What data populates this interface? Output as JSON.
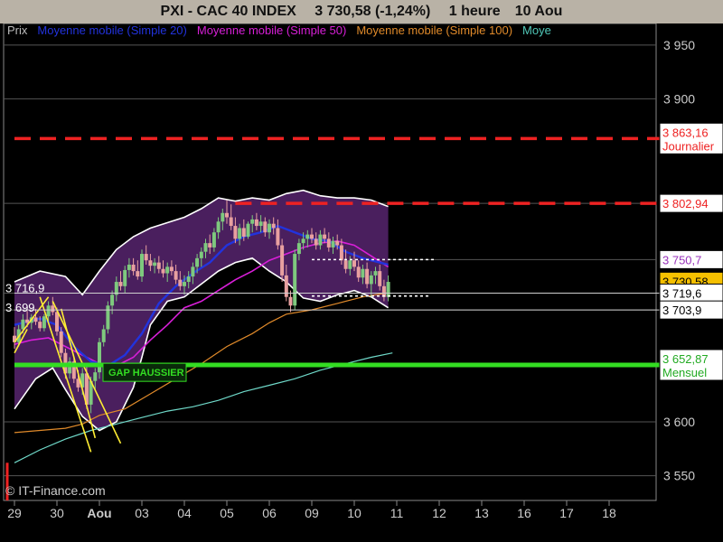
{
  "header": {
    "symbol": "PXI - CAC 40 INDEX",
    "last": "3 730,58 (-1,24%)",
    "period": "1 heure",
    "date": "10 Aou"
  },
  "legend": [
    {
      "label": "Prix",
      "color": "#bbbbbb"
    },
    {
      "label": "Moyenne mobile (Simple 20)",
      "color": "#2233dd"
    },
    {
      "label": "Moyenne mobile (Simple 50)",
      "color": "#d81fd8"
    },
    {
      "label": "Moyenne mobile (Simple 100)",
      "color": "#e08a2a"
    },
    {
      "label": "Moye",
      "color": "#50c8b8"
    }
  ],
  "watermark": "© IT-Finance.com",
  "colors": {
    "background": "#000000",
    "bollinger_fill": "#4a1f5e",
    "up_candle": "#7ec97e",
    "down_candle": "#e8a0a0",
    "ma20": "#2233dd",
    "ma50": "#d81fd8",
    "ma100": "#e08a2a",
    "ma200": "#6fd9c9",
    "resistance": "#ee2222",
    "support": "#33dd22",
    "trend": "#ffee33"
  },
  "chart_data": {
    "type": "candlestick",
    "y_range": [
      3527,
      3970
    ],
    "y_ticks": [
      {
        "value": 3950,
        "label": "3 950"
      },
      {
        "value": 3900,
        "label": "3 900"
      },
      {
        "value": 3600,
        "label": "3 600"
      },
      {
        "value": 3550,
        "label": "3 550"
      }
    ],
    "x_labels": [
      {
        "i": 0,
        "label": "29"
      },
      {
        "i": 1,
        "label": "30"
      },
      {
        "i": 2,
        "label": "Aou"
      },
      {
        "i": 3,
        "label": "03"
      },
      {
        "i": 4,
        "label": "04"
      },
      {
        "i": 5,
        "label": "05"
      },
      {
        "i": 6,
        "label": "06"
      },
      {
        "i": 7,
        "label": "09"
      },
      {
        "i": 8,
        "label": "10"
      },
      {
        "i": 9,
        "label": "11"
      },
      {
        "i": 10,
        "label": "12"
      },
      {
        "i": 11,
        "label": "13"
      },
      {
        "i": 12,
        "label": "16"
      },
      {
        "i": 13,
        "label": "17"
      },
      {
        "i": 14,
        "label": "18"
      }
    ],
    "price_tags": [
      {
        "value": 3863.16,
        "label": "3 863,16",
        "sub": "Journalier",
        "bg": "#ffffff",
        "fg": "#ee2222"
      },
      {
        "value": 3802.94,
        "label": "3 802,94",
        "bg": "#ffffff",
        "fg": "#ee2222"
      },
      {
        "value": 3750.7,
        "label": "3 750,7",
        "bg": "#ffffff",
        "fg": "#9933bb"
      },
      {
        "value": 3730.58,
        "label": "3 730,58",
        "bg": "#f5c000",
        "fg": "#000000"
      },
      {
        "value": 3719.6,
        "label": "3 719,6",
        "bg": "#ffffff",
        "fg": "#000000"
      },
      {
        "value": 3703.9,
        "label": "3 703,9",
        "bg": "#ffffff",
        "fg": "#000000"
      },
      {
        "value": 3652.87,
        "label": "3 652,87",
        "sub": "Mensuel",
        "bg": "#ffffff",
        "fg": "#22aa22"
      }
    ],
    "left_labels": [
      {
        "value": 3716.9,
        "label": "3 716,9"
      },
      {
        "value": 3699,
        "label": "3 699"
      }
    ],
    "levels": [
      {
        "name": "resistance-journalier",
        "value": 3863.16,
        "from": 0,
        "to": 15.2
      },
      {
        "name": "resistance-3802",
        "value": 3802.94,
        "from": 5.2,
        "to": 15.2
      },
      {
        "name": "support-mensuel",
        "value": 3652.87,
        "from": 0,
        "to": 15.2
      },
      {
        "name": "pivot-3703",
        "value": 3703.9,
        "from": 0,
        "to": 15.2
      },
      {
        "name": "pivot-3719",
        "value": 3719.6,
        "from": 0,
        "to": 15.2
      }
    ],
    "dotted_levels": [
      {
        "value": 3750.7,
        "from": 7.0,
        "to": 9.9
      },
      {
        "value": 3716.9,
        "from": 7.0,
        "to": 9.8
      }
    ],
    "annotation": {
      "label": "GAP HAUSSIER",
      "x": 2.0,
      "y": 3646
    },
    "candles": [
      [
        0.0,
        3680,
        3688,
        3668,
        3674
      ],
      [
        0.1,
        3674,
        3690,
        3670,
        3686
      ],
      [
        0.2,
        3686,
        3700,
        3682,
        3695
      ],
      [
        0.3,
        3695,
        3703,
        3688,
        3692
      ],
      [
        0.4,
        3692,
        3700,
        3686,
        3697
      ],
      [
        0.5,
        3697,
        3705,
        3690,
        3693
      ],
      [
        0.6,
        3693,
        3698,
        3684,
        3687
      ],
      [
        0.7,
        3687,
        3700,
        3684,
        3698
      ],
      [
        0.8,
        3698,
        3712,
        3694,
        3708
      ],
      [
        0.9,
        3708,
        3716,
        3699,
        3702
      ],
      [
        1.0,
        3702,
        3706,
        3680,
        3684
      ],
      [
        1.1,
        3684,
        3688,
        3660,
        3664
      ],
      [
        1.2,
        3664,
        3668,
        3640,
        3645
      ],
      [
        1.3,
        3645,
        3660,
        3640,
        3656
      ],
      [
        1.4,
        3656,
        3660,
        3636,
        3640
      ],
      [
        1.5,
        3640,
        3648,
        3628,
        3632
      ],
      [
        1.6,
        3632,
        3650,
        3625,
        3645
      ],
      [
        1.7,
        3645,
        3652,
        3612,
        3616
      ],
      [
        1.8,
        3616,
        3642,
        3608,
        3638
      ],
      [
        1.9,
        3638,
        3650,
        3630,
        3646
      ],
      [
        2.0,
        3646,
        3678,
        3640,
        3674
      ],
      [
        2.1,
        3674,
        3690,
        3670,
        3686
      ],
      [
        2.2,
        3686,
        3712,
        3682,
        3708
      ],
      [
        2.3,
        3708,
        3722,
        3700,
        3718
      ],
      [
        2.4,
        3718,
        3735,
        3712,
        3730
      ],
      [
        2.5,
        3730,
        3740,
        3722,
        3726
      ],
      [
        2.6,
        3726,
        3745,
        3720,
        3741
      ],
      [
        2.7,
        3741,
        3752,
        3734,
        3746
      ],
      [
        2.8,
        3746,
        3752,
        3736,
        3740
      ],
      [
        2.9,
        3740,
        3750,
        3732,
        3735
      ],
      [
        3.0,
        3735,
        3760,
        3730,
        3756
      ],
      [
        3.1,
        3756,
        3764,
        3746,
        3750
      ],
      [
        3.2,
        3750,
        3756,
        3740,
        3745
      ],
      [
        3.3,
        3745,
        3752,
        3738,
        3748
      ],
      [
        3.4,
        3748,
        3754,
        3738,
        3742
      ],
      [
        3.5,
        3742,
        3750,
        3734,
        3738
      ],
      [
        3.6,
        3738,
        3748,
        3730,
        3744
      ],
      [
        3.7,
        3744,
        3750,
        3736,
        3740
      ],
      [
        3.8,
        3740,
        3746,
        3728,
        3732
      ],
      [
        3.9,
        3732,
        3740,
        3722,
        3726
      ],
      [
        4.0,
        3726,
        3736,
        3718,
        3730
      ],
      [
        4.1,
        3730,
        3740,
        3724,
        3735
      ],
      [
        4.2,
        3735,
        3748,
        3728,
        3744
      ],
      [
        4.3,
        3744,
        3756,
        3738,
        3752
      ],
      [
        4.4,
        3752,
        3762,
        3744,
        3758
      ],
      [
        4.5,
        3758,
        3770,
        3752,
        3766
      ],
      [
        4.6,
        3766,
        3774,
        3756,
        3762
      ],
      [
        4.7,
        3762,
        3780,
        3758,
        3776
      ],
      [
        4.8,
        3776,
        3790,
        3770,
        3786
      ],
      [
        4.9,
        3786,
        3798,
        3778,
        3794
      ],
      [
        5.0,
        3794,
        3806,
        3784,
        3790
      ],
      [
        5.1,
        3790,
        3802,
        3778,
        3782
      ],
      [
        5.2,
        3782,
        3790,
        3766,
        3770
      ],
      [
        5.3,
        3770,
        3784,
        3764,
        3780
      ],
      [
        5.4,
        3780,
        3788,
        3768,
        3772
      ],
      [
        5.5,
        3772,
        3786,
        3770,
        3784
      ],
      [
        5.6,
        3784,
        3792,
        3776,
        3788
      ],
      [
        5.7,
        3788,
        3794,
        3778,
        3782
      ],
      [
        5.8,
        3782,
        3792,
        3776,
        3786
      ],
      [
        5.9,
        3786,
        3790,
        3772,
        3776
      ],
      [
        6.0,
        3776,
        3788,
        3770,
        3784
      ],
      [
        6.1,
        3784,
        3790,
        3774,
        3780
      ],
      [
        6.2,
        3780,
        3788,
        3760,
        3764
      ],
      [
        6.3,
        3764,
        3770,
        3730,
        3736
      ],
      [
        6.4,
        3736,
        3746,
        3712,
        3716
      ],
      [
        6.5,
        3716,
        3722,
        3702,
        3708
      ],
      [
        6.6,
        3708,
        3760,
        3704,
        3756
      ],
      [
        6.7,
        3756,
        3770,
        3750,
        3766
      ],
      [
        6.8,
        3766,
        3776,
        3760,
        3770
      ],
      [
        6.9,
        3770,
        3778,
        3762,
        3774
      ],
      [
        7.0,
        3774,
        3780,
        3766,
        3770
      ],
      [
        7.1,
        3770,
        3776,
        3760,
        3764
      ],
      [
        7.2,
        3764,
        3778,
        3760,
        3774
      ],
      [
        7.3,
        3774,
        3780,
        3766,
        3770
      ],
      [
        7.4,
        3770,
        3776,
        3758,
        3762
      ],
      [
        7.5,
        3762,
        3772,
        3756,
        3768
      ],
      [
        7.6,
        3768,
        3774,
        3760,
        3764
      ],
      [
        7.7,
        3764,
        3770,
        3746,
        3750
      ],
      [
        7.8,
        3750,
        3760,
        3738,
        3742
      ],
      [
        7.9,
        3742,
        3754,
        3736,
        3750
      ],
      [
        8.0,
        3750,
        3758,
        3740,
        3744
      ],
      [
        8.1,
        3744,
        3750,
        3730,
        3734
      ],
      [
        8.2,
        3734,
        3746,
        3728,
        3742
      ],
      [
        8.3,
        3742,
        3748,
        3724,
        3728
      ],
      [
        8.4,
        3728,
        3740,
        3716,
        3736
      ],
      [
        8.5,
        3736,
        3744,
        3728,
        3740
      ],
      [
        8.6,
        3740,
        3746,
        3722,
        3726
      ],
      [
        8.7,
        3726,
        3732,
        3712,
        3716
      ],
      [
        8.8,
        3716,
        3736,
        3712,
        3730
      ]
    ],
    "bollinger_upper": [
      [
        0.0,
        3730
      ],
      [
        0.6,
        3740
      ],
      [
        1.2,
        3735
      ],
      [
        1.6,
        3718
      ],
      [
        2.0,
        3740
      ],
      [
        2.4,
        3760
      ],
      [
        2.8,
        3772
      ],
      [
        3.2,
        3780
      ],
      [
        3.6,
        3785
      ],
      [
        4.0,
        3790
      ],
      [
        4.4,
        3798
      ],
      [
        4.8,
        3808
      ],
      [
        5.2,
        3805
      ],
      [
        5.6,
        3808
      ],
      [
        6.0,
        3806
      ],
      [
        6.4,
        3812
      ],
      [
        6.8,
        3815
      ],
      [
        7.2,
        3810
      ],
      [
        7.6,
        3808
      ],
      [
        8.0,
        3808
      ],
      [
        8.4,
        3806
      ],
      [
        8.8,
        3800
      ]
    ],
    "bollinger_lower": [
      [
        0.0,
        3612
      ],
      [
        0.5,
        3640
      ],
      [
        0.9,
        3650
      ],
      [
        1.2,
        3630
      ],
      [
        1.6,
        3605
      ],
      [
        2.0,
        3592
      ],
      [
        2.4,
        3600
      ],
      [
        2.8,
        3632
      ],
      [
        3.0,
        3660
      ],
      [
        3.2,
        3690
      ],
      [
        3.6,
        3712
      ],
      [
        4.0,
        3716
      ],
      [
        4.4,
        3728
      ],
      [
        4.8,
        3740
      ],
      [
        5.2,
        3748
      ],
      [
        5.6,
        3752
      ],
      [
        6.0,
        3740
      ],
      [
        6.4,
        3730
      ],
      [
        6.8,
        3715
      ],
      [
        7.2,
        3712
      ],
      [
        7.6,
        3718
      ],
      [
        8.0,
        3722
      ],
      [
        8.4,
        3716
      ],
      [
        8.8,
        3706
      ]
    ],
    "ma20": [
      [
        0.0,
        3690
      ],
      [
        0.6,
        3696
      ],
      [
        1.0,
        3690
      ],
      [
        1.4,
        3670
      ],
      [
        1.8,
        3656
      ],
      [
        2.2,
        3652
      ],
      [
        2.6,
        3662
      ],
      [
        3.0,
        3682
      ],
      [
        3.4,
        3710
      ],
      [
        3.8,
        3726
      ],
      [
        4.2,
        3738
      ],
      [
        4.6,
        3748
      ],
      [
        5.0,
        3764
      ],
      [
        5.4,
        3772
      ],
      [
        5.8,
        3776
      ],
      [
        6.2,
        3782
      ],
      [
        6.6,
        3776
      ],
      [
        7.0,
        3770
      ],
      [
        7.4,
        3768
      ],
      [
        7.8,
        3758
      ],
      [
        8.2,
        3752
      ],
      [
        8.6,
        3748
      ],
      [
        8.8,
        3746
      ]
    ],
    "ma50": [
      [
        0.0,
        3672
      ],
      [
        0.4,
        3676
      ],
      [
        0.8,
        3678
      ],
      [
        1.2,
        3670
      ],
      [
        1.6,
        3662
      ],
      [
        2.0,
        3654
      ],
      [
        2.4,
        3652
      ],
      [
        2.8,
        3660
      ],
      [
        3.2,
        3676
      ],
      [
        3.6,
        3690
      ],
      [
        4.0,
        3706
      ],
      [
        4.4,
        3712
      ],
      [
        4.8,
        3722
      ],
      [
        5.2,
        3732
      ],
      [
        5.6,
        3740
      ],
      [
        6.0,
        3750
      ],
      [
        6.4,
        3756
      ],
      [
        6.8,
        3762
      ],
      [
        7.2,
        3766
      ],
      [
        7.6,
        3768
      ],
      [
        8.0,
        3764
      ],
      [
        8.4,
        3754
      ],
      [
        8.8,
        3744
      ]
    ],
    "ma100": [
      [
        0.0,
        3590
      ],
      [
        0.6,
        3592
      ],
      [
        1.2,
        3594
      ],
      [
        1.6,
        3598
      ],
      [
        2.0,
        3606
      ],
      [
        2.6,
        3612
      ],
      [
        3.2,
        3626
      ],
      [
        3.8,
        3640
      ],
      [
        4.4,
        3654
      ],
      [
        5.0,
        3670
      ],
      [
        5.6,
        3682
      ],
      [
        6.0,
        3692
      ],
      [
        6.4,
        3700
      ],
      [
        7.0,
        3704
      ],
      [
        7.6,
        3710
      ],
      [
        8.2,
        3716
      ],
      [
        8.8,
        3720
      ]
    ],
    "ma200": [
      [
        0.0,
        3562
      ],
      [
        0.6,
        3574
      ],
      [
        1.2,
        3584
      ],
      [
        1.8,
        3592
      ],
      [
        2.4,
        3598
      ],
      [
        3.0,
        3604
      ],
      [
        3.6,
        3610
      ],
      [
        4.2,
        3614
      ],
      [
        4.8,
        3620
      ],
      [
        5.4,
        3628
      ],
      [
        6.0,
        3634
      ],
      [
        6.6,
        3640
      ],
      [
        7.2,
        3648
      ],
      [
        7.8,
        3654
      ],
      [
        8.4,
        3660
      ],
      [
        8.9,
        3664
      ]
    ],
    "trendlines": [
      [
        [
          0.0,
          3664
        ],
        [
          0.3,
          3686
        ]
      ],
      [
        [
          0.0,
          3674
        ],
        [
          0.8,
          3716
        ]
      ],
      [
        [
          0.6,
          3716
        ],
        [
          1.8,
          3572
        ]
      ],
      [
        [
          0.9,
          3712
        ],
        [
          2.5,
          3580
        ]
      ],
      [
        [
          1.1,
          3705
        ],
        [
          1.9,
          3585
        ]
      ]
    ],
    "markers": [
      {
        "x": 0.0,
        "y_top": 3562,
        "y_bottom": 3527,
        "color": "#ee2222"
      }
    ]
  }
}
